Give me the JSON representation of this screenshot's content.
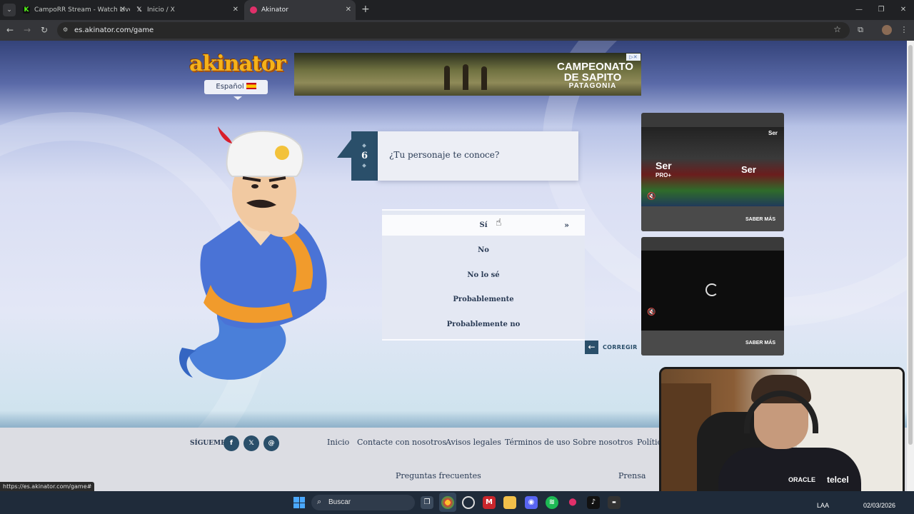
{
  "browser": {
    "tabs": [
      {
        "title": "CampoRR Stream - Watch Live",
        "favicon_color": "#53fc18"
      },
      {
        "title": "Inicio / X",
        "favicon_color": "#ffffff"
      },
      {
        "title": "Akinator",
        "favicon_color": "#e0306a"
      }
    ],
    "new_tab": "+",
    "url": "es.akinator.com/game",
    "status_url": "https://es.akinator.com/game#"
  },
  "site": {
    "logo": "akinator",
    "language": "Español",
    "ad_banner": {
      "headline": "CAMPEONATO DE SAPITO",
      "sub": "PATAGONIA"
    }
  },
  "game": {
    "question_number": "6",
    "question": "¿Tu personaje te conoce?",
    "answers": [
      "Sí",
      "No",
      "No lo sé",
      "Probablemente",
      "Probablemente no"
    ],
    "selected_chevron": "»",
    "corregir": "CORREGIR"
  },
  "side_ads": [
    {
      "cta": "SABER MÁS",
      "brand": "Ser",
      "product": "PRO+"
    },
    {
      "cta": "SABER MÁS"
    }
  ],
  "footer": {
    "follow_label": "SÍGUEME",
    "social": [
      "facebook",
      "x",
      "threads"
    ],
    "links": [
      "Inicio",
      "Contacte con nosotros",
      "Avisos legales",
      "Términos de uso",
      "Sobre nosotros",
      "Polític"
    ],
    "links_row2": [
      "Preguntas frecuentes",
      "Prensa"
    ]
  },
  "webcam": {
    "sponsor1": "ORACLE",
    "sponsor2": "telcel"
  },
  "taskbar": {
    "search_placeholder": "Buscar",
    "language": "LAA",
    "date": "02/03/2026"
  },
  "colors": {
    "accent": "#2a4f6a",
    "logo": "#f5b21a"
  }
}
